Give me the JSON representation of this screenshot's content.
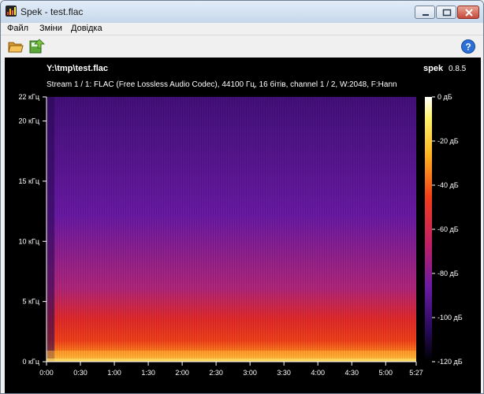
{
  "window": {
    "title": "Spek - test.flac"
  },
  "menu": [
    "Файл",
    "Зміни",
    "Довідка"
  ],
  "toolbar": {
    "open_icon": "folder-open-icon",
    "save_icon": "save-icon",
    "help_icon": "help-icon"
  },
  "spectrogram": {
    "file_name": "Y:\\tmp\\test.flac",
    "app_name": "spek",
    "app_version": "0.8.5",
    "stream_info": "Stream 1 / 1: FLAC (Free Lossless Audio Codec), 44100 Гц, 16 бітів, channel 1 / 2, W:2048, F:Hann",
    "freq_ticks": [
      "22 кГц",
      "20 кГц",
      "15 кГц",
      "10 кГц",
      "5 кГц",
      "0 кГц"
    ],
    "time_ticks": [
      "0:00",
      "0:30",
      "1:00",
      "1:30",
      "2:00",
      "2:30",
      "3:00",
      "3:30",
      "4:00",
      "4:30",
      "5:00",
      "5:27"
    ],
    "db_ticks": [
      "0 дБ",
      "-20 дБ",
      "-40 дБ",
      "-60 дБ",
      "-80 дБ",
      "-100 дБ",
      "-120 дБ"
    ]
  },
  "colors": {
    "background": "#000000",
    "text": "#ffffff"
  }
}
